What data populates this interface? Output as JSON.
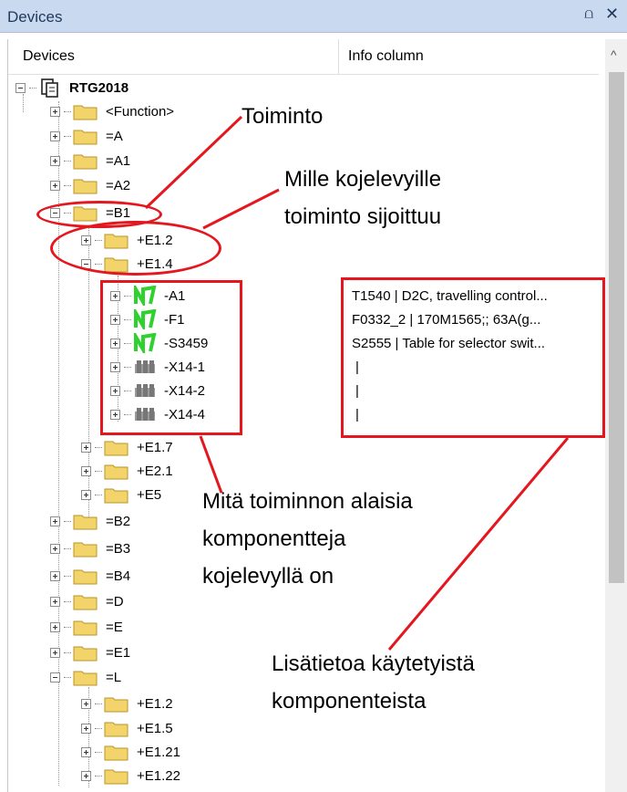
{
  "window": {
    "title": "Devices",
    "pin_glyph": "⩍",
    "close_glyph": "✕"
  },
  "columns": {
    "devices": "Devices",
    "info": "Info column"
  },
  "scroll": {
    "up_glyph": "^"
  },
  "tree": {
    "root": "RTG2018",
    "level1_top": [
      "<Function>",
      "=A",
      "=A1",
      "=A2"
    ],
    "b1": "=B1",
    "b1_children_top": [
      "+E1.2",
      "+E1.4"
    ],
    "e14_children": [
      "-A1",
      "-F1",
      "-S3459",
      "-X14-1",
      "-X14-2",
      "-X14-4"
    ],
    "b1_children_bottom": [
      "+E1.7",
      "+E2.1",
      "+E5"
    ],
    "level1_mid": [
      "=B2",
      "=B3",
      "=B4",
      "=D",
      "=E",
      "=E1"
    ],
    "l": "=L",
    "l_children": [
      "+E1.2",
      "+E1.5",
      "+E1.21",
      "+E1.22"
    ]
  },
  "info_column": {
    "values": [
      "T1540 | D2C, travelling control...",
      "F0332_2 | 170M1565;; 63A(g...",
      "S2555 | Table for selector swit...",
      "|",
      "|",
      "|"
    ]
  },
  "annotations": {
    "toiminto": "Toiminto",
    "mille": [
      "Mille kojelevyille",
      "toiminto sijoittuu"
    ],
    "mita": [
      "Mitä toiminnon alaisia",
      "komponentteja",
      "kojelevyllä on"
    ],
    "lisatietoa": [
      "Lisätietoa käytetyistä",
      "komponenteista"
    ]
  },
  "colors": {
    "annotation_red": "#e4161e",
    "titlebar": "#c9d9ef",
    "folder": "#f3d46b",
    "device_green": "#2fd12f"
  },
  "icons": {
    "root": "document-tree-icon",
    "folder": "folder-icon",
    "device": "device-symbol-icon",
    "terminal": "terminal-strip-icon"
  }
}
